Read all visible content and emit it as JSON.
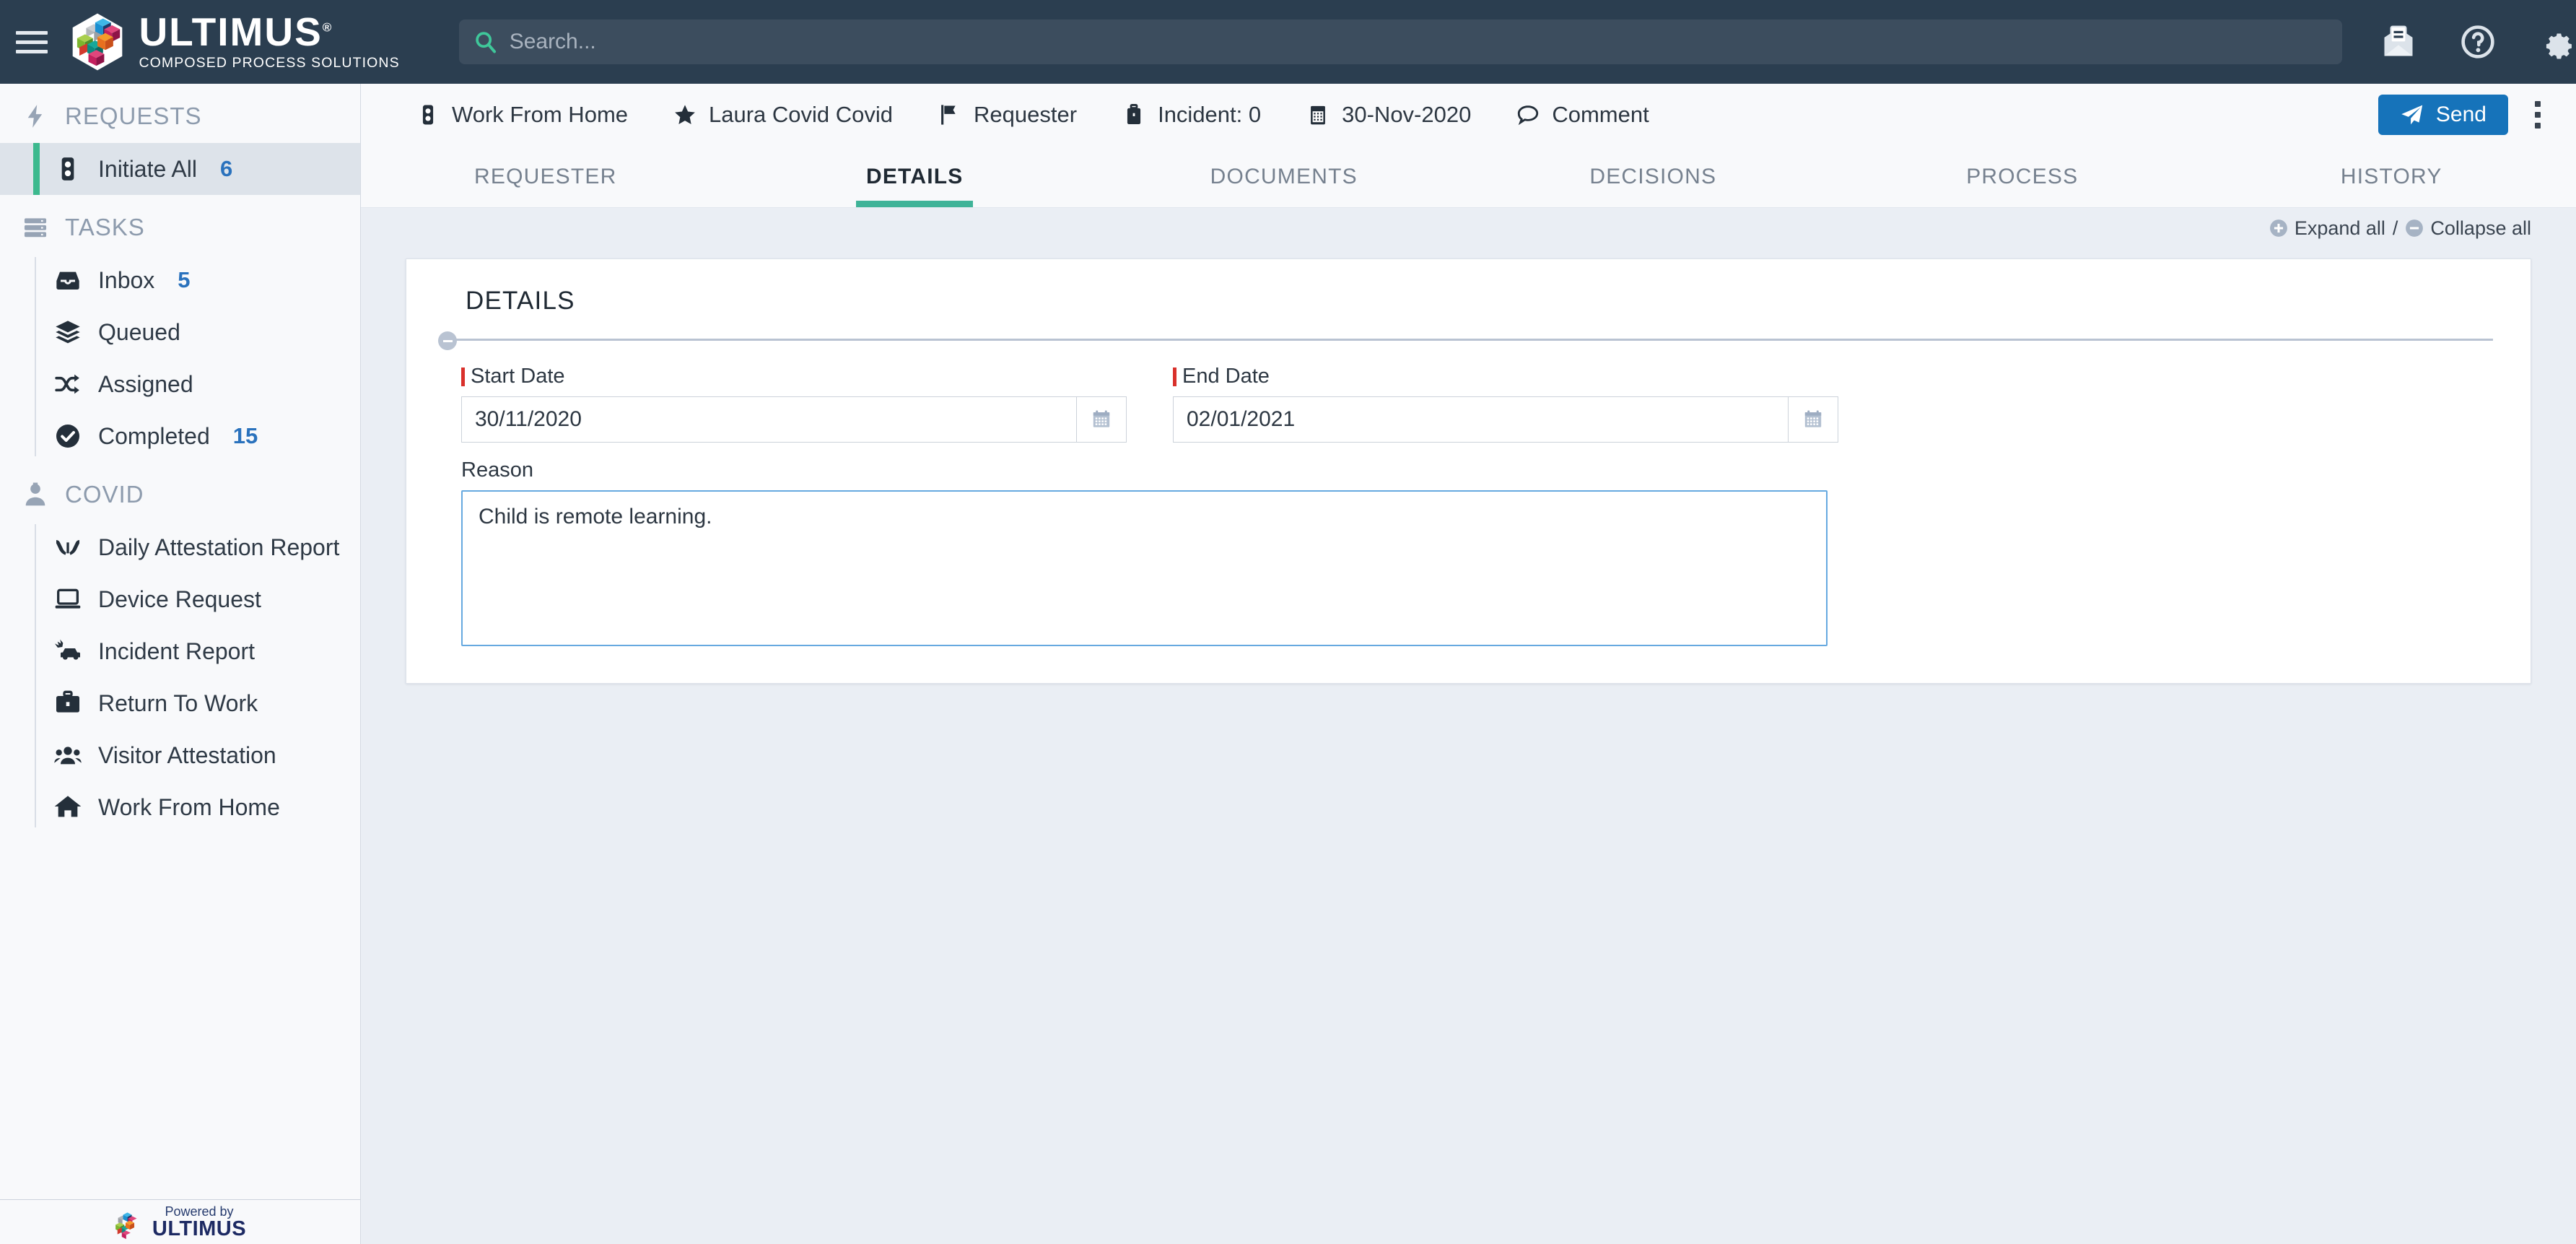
{
  "brand": {
    "name": "ULTIMUS",
    "registered": "®",
    "tagline": "COMPOSED PROCESS SOLUTIONS"
  },
  "header": {
    "menu_icon": "hamburger-icon",
    "search": {
      "value": "",
      "placeholder": "Search...",
      "icon": "search-icon"
    },
    "icons": [
      {
        "name": "mail-icon",
        "label": "Mail"
      },
      {
        "name": "help-icon",
        "label": "Help"
      },
      {
        "name": "settings-gear-icon",
        "label": "Settings"
      }
    ]
  },
  "sidebar": {
    "groups": [
      {
        "label": "REQUESTS",
        "icon": "bolt-icon",
        "items": [
          {
            "label": "Initiate All",
            "count": "6",
            "icon": "traffic-light-icon",
            "active": true
          }
        ]
      },
      {
        "label": "TASKS",
        "icon": "stack-icon",
        "items": [
          {
            "label": "Inbox",
            "count": "5",
            "icon": "inbox-icon",
            "active": false
          },
          {
            "label": "Queued",
            "count": "",
            "icon": "layers-icon",
            "active": false
          },
          {
            "label": "Assigned",
            "count": "",
            "icon": "shuffle-icon",
            "active": false
          },
          {
            "label": "Completed",
            "count": "15",
            "icon": "check-circle-icon",
            "active": false
          }
        ]
      },
      {
        "label": "COVID",
        "icon": "doctor-icon",
        "items": [
          {
            "label": "Daily Attestation Report",
            "count": "",
            "icon": "hands-icon",
            "active": false
          },
          {
            "label": "Device Request",
            "count": "",
            "icon": "laptop-icon",
            "active": false
          },
          {
            "label": "Incident Report",
            "count": "",
            "icon": "car-crash-icon",
            "active": false
          },
          {
            "label": "Return To Work",
            "count": "",
            "icon": "briefcase-icon",
            "active": false
          },
          {
            "label": "Visitor Attestation",
            "count": "",
            "icon": "users-icon",
            "active": false
          },
          {
            "label": "Work From Home",
            "count": "",
            "icon": "home-icon",
            "active": false
          }
        ]
      }
    ],
    "footer": {
      "powered_by": "Powered by",
      "brand": "ULTIMUS",
      "registered": "®"
    }
  },
  "breadcrumb": {
    "items": [
      {
        "label": "Work From Home",
        "icon": "traffic-light-icon"
      },
      {
        "label": "Laura Covid Covid",
        "icon": "star-icon"
      },
      {
        "label": "Requester",
        "icon": "flag-icon"
      },
      {
        "label": "Incident: 0",
        "icon": "briefcase-icon"
      },
      {
        "label": "30-Nov-2020",
        "icon": "calendar-icon"
      },
      {
        "label": "Comment",
        "icon": "comment-icon"
      }
    ],
    "send_label": "Send",
    "send_icon": "paper-plane-icon",
    "more_icon": "kebab-menu-icon"
  },
  "tabs": [
    {
      "label": "REQUESTER",
      "active": false
    },
    {
      "label": "DETAILS",
      "active": true
    },
    {
      "label": "DOCUMENTS",
      "active": false
    },
    {
      "label": "DECISIONS",
      "active": false
    },
    {
      "label": "PROCESS",
      "active": false
    },
    {
      "label": "HISTORY",
      "active": false
    }
  ],
  "expand_bar": {
    "expand_label": "Expand all",
    "separator": "/",
    "collapse_label": "Collapse all"
  },
  "details_card": {
    "title": "DETAILS",
    "start_date": {
      "label": "Start Date",
      "required": true,
      "value": "30/11/2020",
      "placeholder": "",
      "calendar_icon": "calendar-icon"
    },
    "end_date": {
      "label": "End Date",
      "required": true,
      "value": "02/01/2021",
      "placeholder": "",
      "calendar_icon": "calendar-icon"
    },
    "reason": {
      "label": "Reason",
      "required": false,
      "value": "Child is remote learning.",
      "placeholder": ""
    }
  },
  "colors": {
    "topbar": "#2b3e50",
    "accent_teal": "#3fb398",
    "accent_blue": "#1673ba",
    "count_blue": "#2a72bd",
    "required_red": "#d9302b",
    "page_bg": "#eaeef4",
    "sidebar_bg": "#f8f9fb"
  }
}
